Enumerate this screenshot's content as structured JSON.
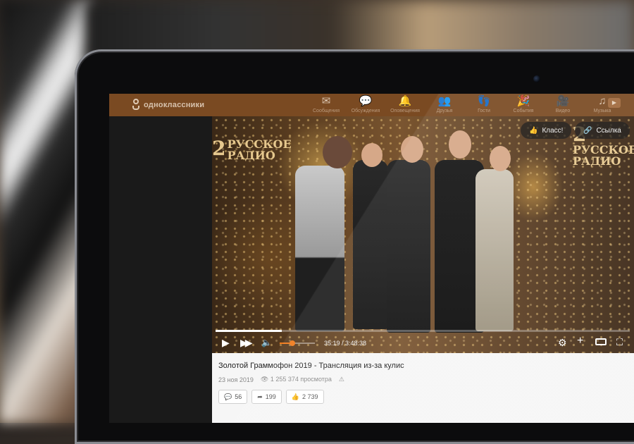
{
  "topbar": {
    "logo_text": "одноклассники",
    "nav": [
      {
        "label": "Сообщения",
        "icon": "envelope-icon"
      },
      {
        "label": "Обсуждения",
        "icon": "chat-bubbles-icon"
      },
      {
        "label": "Оповещения",
        "icon": "bell-icon"
      },
      {
        "label": "Друзья",
        "icon": "friends-icon"
      },
      {
        "label": "Гости",
        "icon": "footprints-icon"
      },
      {
        "label": "События",
        "icon": "events-icon"
      },
      {
        "label": "Видео",
        "icon": "video-camera-icon"
      },
      {
        "label": "Музыка",
        "icon": "music-note-icon"
      }
    ]
  },
  "video": {
    "overlay_logo_number": "2",
    "overlay_logo_text_line1": "РУССКОЕ",
    "overlay_logo_text_line2": "РАДИО",
    "like_chip_label": "Класс!",
    "link_chip_label": "Ссылка",
    "time_display": "35:19 / 3:48:38",
    "progress_fraction": 0.16,
    "volume_fraction": 0.35
  },
  "info": {
    "title": "Золотой Граммофон 2019 - Трансляция из-за кулис",
    "date": "23 ноя 2019",
    "views": "1 255 374 просмотра",
    "comments_count": "56",
    "shares_count": "199",
    "likes_count": "2 739"
  },
  "colors": {
    "topbar": "#7a4a22",
    "accent_orange": "#f07a1a"
  }
}
